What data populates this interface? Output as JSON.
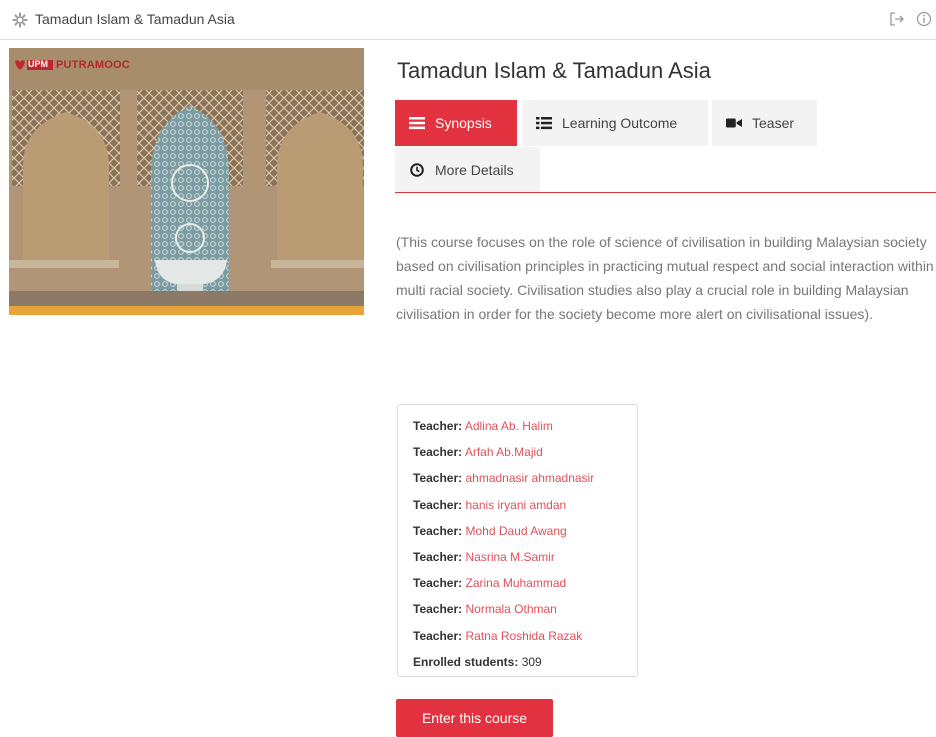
{
  "header": {
    "title": "Tamadun Islam & Tamadun Asia",
    "icons": [
      "course-icon",
      "exit-icon",
      "info-icon"
    ]
  },
  "image": {
    "logo_upm": "UPM",
    "logo_text": "PUTRAMOOC"
  },
  "course": {
    "title": "Tamadun Islam & Tamadun Asia"
  },
  "tabs": [
    {
      "label": "Synopsis",
      "icon": "list-icon",
      "active": true
    },
    {
      "label": "Learning Outcome",
      "icon": "list-bullets-icon",
      "active": false
    },
    {
      "label": "Teaser",
      "icon": "video-camera-icon",
      "active": false
    },
    {
      "label": "More Details",
      "icon": "clock-icon",
      "active": false
    }
  ],
  "synopsis": "(This course focuses on the role of science of civilisation in building Malaysian society based on civilisation principles in practicing mutual respect and social interaction within multi racial society. Civilisation studies also play a crucial role in building Malaysian civilisation in order for the society become more alert on civilisational issues).",
  "teachers": {
    "label": "Teacher:",
    "names": [
      "Adlina Ab. Halim",
      "Arfah Ab.Majid",
      "ahmadnasir ahmadnasir",
      "hanis iryani amdan",
      "Mohd Daud Awang",
      "Nasrina M.Samir",
      "Zarina Muhammad",
      "Normala Othman",
      "Ratna Roshida Razak"
    ],
    "enrolled_label": "Enrolled students:",
    "enrolled_count": "309"
  },
  "enter_button": "Enter this course",
  "colors": {
    "accent": "#e2323f",
    "link": "#e0505a"
  }
}
